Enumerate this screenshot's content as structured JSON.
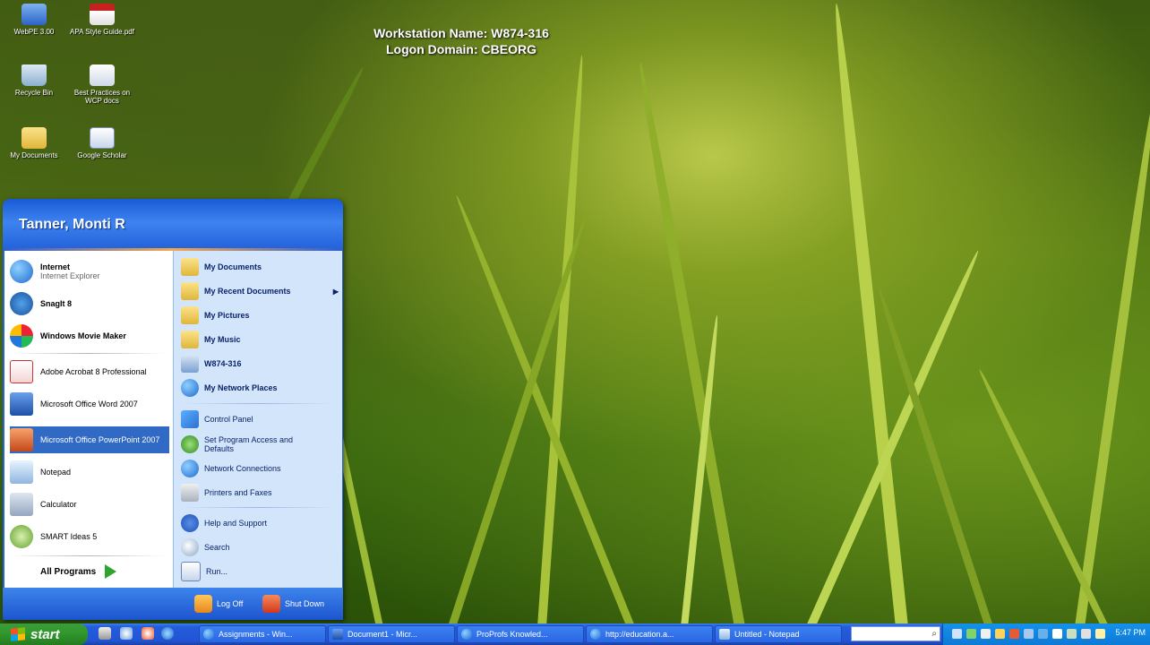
{
  "desktop": {
    "workstation_line": "Workstation Name: W874-316",
    "domain_line": "Logon Domain: CBEORG",
    "icons": [
      {
        "label": "WebPE 3.00",
        "icon": "window-icon"
      },
      {
        "label": "APA Style Guide.pdf",
        "icon": "pdf-icon"
      },
      {
        "label": "Recycle Bin",
        "icon": "recycle-bin-icon"
      },
      {
        "label": "Best Practices on WCP docs",
        "icon": "document-icon"
      },
      {
        "label": "My Documents",
        "icon": "folder-icon"
      },
      {
        "label": "Google Scholar",
        "icon": "shortcut-icon"
      }
    ]
  },
  "start_menu": {
    "user_name": "Tanner, Monti R",
    "pinned": [
      {
        "label": "Internet",
        "sub": "Internet Explorer",
        "icon": "internet-explorer-icon"
      },
      {
        "label": "SnagIt 8",
        "sub": "",
        "icon": "snagit-icon"
      },
      {
        "label": "Windows Movie Maker",
        "sub": "",
        "icon": "movie-maker-icon"
      }
    ],
    "recent": [
      {
        "label": "Adobe Acrobat 8 Professional",
        "icon": "acrobat-icon"
      },
      {
        "label": "Microsoft Office Word 2007",
        "icon": "word-icon"
      },
      {
        "label": "Microsoft Office PowerPoint 2007",
        "icon": "powerpoint-icon"
      },
      {
        "label": "Notepad",
        "icon": "notepad-icon"
      },
      {
        "label": "Calculator",
        "icon": "calculator-icon"
      },
      {
        "label": "SMART Ideas 5",
        "icon": "smart-ideas-icon"
      }
    ],
    "all_programs": "All Programs",
    "right_top": [
      {
        "label": "My Documents",
        "icon": "folder-icon"
      },
      {
        "label": "My Recent Documents",
        "icon": "recent-documents-icon",
        "has_submenu": true
      },
      {
        "label": "My Pictures",
        "icon": "folder-icon"
      },
      {
        "label": "My Music",
        "icon": "folder-icon"
      },
      {
        "label": "W874-316",
        "icon": "computer-icon"
      },
      {
        "label": "My Network Places",
        "icon": "network-icon"
      }
    ],
    "right_mid": [
      {
        "label": "Control Panel",
        "icon": "control-panel-icon"
      },
      {
        "label": "Set Program Access and Defaults",
        "icon": "program-access-icon"
      },
      {
        "label": "Network Connections",
        "icon": "network-connections-icon"
      },
      {
        "label": "Printers and Faxes",
        "icon": "printer-icon"
      }
    ],
    "right_bottom": [
      {
        "label": "Help and Support",
        "icon": "help-icon"
      },
      {
        "label": "Search",
        "icon": "search-icon"
      },
      {
        "label": "Run...",
        "icon": "run-icon"
      }
    ],
    "log_off": "Log Off",
    "shut_down": "Shut Down"
  },
  "taskbar": {
    "start_label": "start",
    "tasks": [
      {
        "label": "Assignments - Win...",
        "icon": "internet-explorer-icon"
      },
      {
        "label": "Document1 - Micr...",
        "icon": "word-icon"
      },
      {
        "label": "ProProfs Knowled...",
        "icon": "internet-explorer-icon"
      },
      {
        "label": "http://education.a...",
        "icon": "internet-explorer-icon"
      },
      {
        "label": "Untitled - Notepad",
        "icon": "notepad-icon"
      }
    ],
    "clock": "5:47 PM"
  },
  "colors": {
    "start_menu_blue": "#2a63d8",
    "selection": "#316ac5",
    "taskbar_blue": "#2254d4",
    "start_green": "#329a2e"
  }
}
